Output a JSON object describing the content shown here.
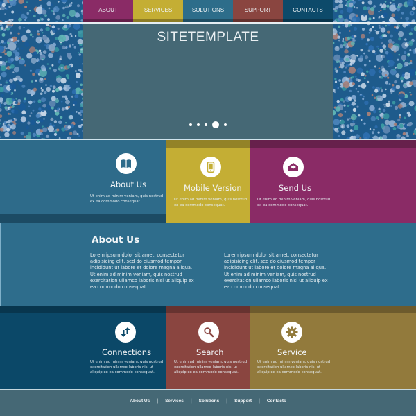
{
  "colors": {
    "purple": "#8a2b66",
    "yellow": "#c4ae34",
    "teal": "#2d6d8a",
    "rust": "#8a4540",
    "navy": "#0d4a6a",
    "hero": "#456875",
    "olive": "#927a3c"
  },
  "nav": {
    "items": [
      {
        "label": "ABOUT",
        "color": "#8a2b66"
      },
      {
        "label": "SERVICES",
        "color": "#c4ae34"
      },
      {
        "label": "SOLUTIONS",
        "color": "#2d6d8a"
      },
      {
        "label": "SUPPORT",
        "color": "#8a4540"
      },
      {
        "label": "CONTACTS",
        "color": "#0d4a6a"
      }
    ]
  },
  "hero": {
    "title": "SITETEMPLATE",
    "slider": {
      "total": 5,
      "active_index": 3
    }
  },
  "features_top": [
    {
      "title": "About Us",
      "icon": "book-icon",
      "text": "Ut enim ad minim veniam, quis nostrud ex ea commodo consequat."
    },
    {
      "title": "Mobile Version",
      "icon": "mobile-phone-icon",
      "text": "Ut enim ad minim veniam, quis nostrud ex ea commodo consequat."
    },
    {
      "title": "Send Us",
      "icon": "envelope-icon",
      "text": "Ut enim ad minim veniam, quis nostrud ex ea commodo consequat."
    }
  ],
  "about": {
    "title": "About Us",
    "col1": "Lorem ipsum dolor sit amet, consectetur adipisicing elit, sed do eiusmod tempor incididunt ut labore et dolore magna aliqua. Ut enim ad minim veniam, quis nostrud exercitation ullamco laboris nisi ut aliquip ex ea commodo consequat.",
    "col2": "Lorem ipsum dolor sit amet, consectetur adipisicing elit, sed do eiusmod tempor incididunt ut labore et dolore magna aliqua. Ut enim ad minim veniam, quis nostrud exercitation ullamco laboris nisi ut aliquip ex ea commodo consequat."
  },
  "features_bottom": [
    {
      "title": "Connections",
      "icon": "connections-arrows-icon",
      "text": "Ut enim ad minim veniam, quis nostrud exercitation ullamco laboris nisi ut aliquip ex ea commodo consequat."
    },
    {
      "title": "Search",
      "icon": "search-icon",
      "text": "Ut enim ad minim veniam, quis nostrud exercitation ullamco laboris nisi ut aliquip ex ea commodo consequat."
    },
    {
      "title": "Service",
      "icon": "gear-icon",
      "text": "Ut enim ad minim veniam, quis nostrud exercitation ullamco laboris nisi ut aliquip ex ea commodo consequat."
    }
  ],
  "footer": {
    "links": [
      "About Us",
      "Services",
      "Solutions",
      "Support",
      "Contacts"
    ],
    "separator": "|"
  }
}
